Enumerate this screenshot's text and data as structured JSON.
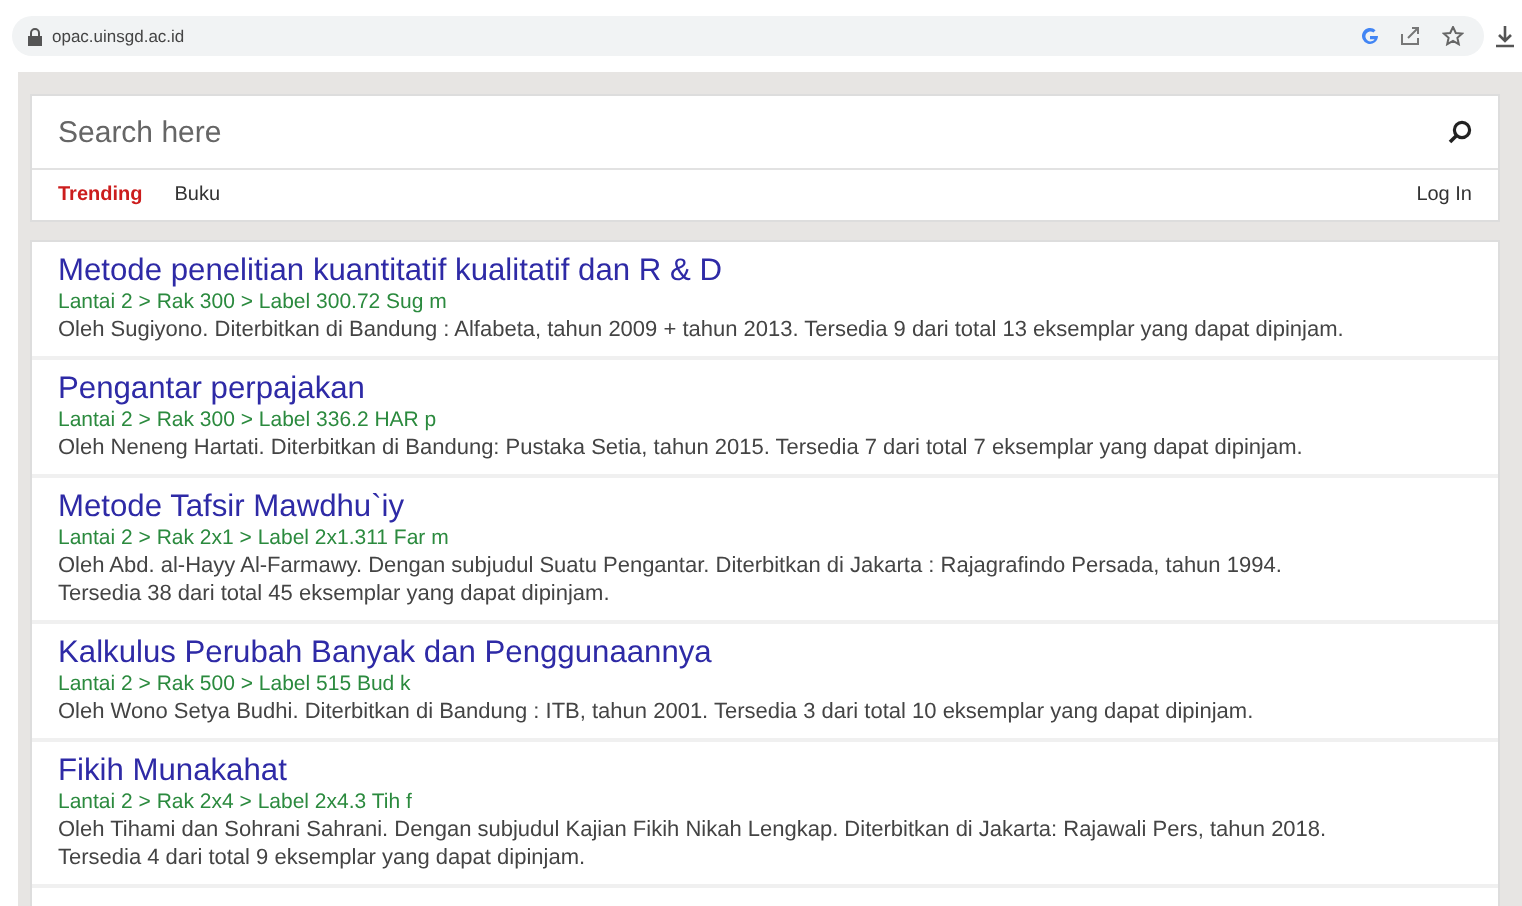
{
  "browser": {
    "url": "opac.uinsgd.ac.id"
  },
  "search": {
    "placeholder": "Search here"
  },
  "tabs": [
    {
      "label": "Trending",
      "selected": true
    },
    {
      "label": "Buku",
      "selected": false
    }
  ],
  "login": "Log In",
  "results": [
    {
      "title": "Metode penelitian kuantitatif kualitatif dan R & D",
      "location": "Lantai 2 > Rak 300 > Label 300.72 Sug m",
      "description": "Oleh Sugiyono. Diterbitkan di Bandung : Alfabeta, tahun 2009 + tahun 2013. Tersedia 9 dari total 13 eksemplar yang dapat dipinjam."
    },
    {
      "title": "Pengantar perpajakan",
      "location": "Lantai 2 > Rak 300 > Label 336.2 HAR p",
      "description": "Oleh Neneng Hartati. Diterbitkan di Bandung: Pustaka Setia, tahun 2015. Tersedia 7 dari total 7 eksemplar yang dapat dipinjam."
    },
    {
      "title": "Metode Tafsir Mawdhu`iy",
      "location": "Lantai 2 > Rak 2x1 > Label 2x1.311 Far m",
      "description": "Oleh Abd. al-Hayy Al-Farmawy. Dengan subjudul Suatu Pengantar. Diterbitkan di Jakarta : Rajagrafindo Persada, tahun 1994. Tersedia 38 dari total 45 eksemplar yang dapat dipinjam."
    },
    {
      "title": "Kalkulus Perubah Banyak dan Penggunaannya",
      "location": "Lantai 2 > Rak 500 > Label 515 Bud k",
      "description": "Oleh Wono Setya Budhi. Diterbitkan di Bandung : ITB, tahun 2001. Tersedia 3 dari total 10 eksemplar yang dapat dipinjam."
    },
    {
      "title": "Fikih Munakahat",
      "location": "Lantai 2 > Rak 2x4 > Label 2x4.3 Tih f",
      "description": "Oleh Tihami dan Sohrani Sahrani. Dengan subjudul Kajian Fikih Nikah Lengkap. Diterbitkan di Jakarta: Rajawali Pers, tahun 2018. Tersedia 4 dari total 9 eksemplar yang dapat dipinjam."
    }
  ]
}
